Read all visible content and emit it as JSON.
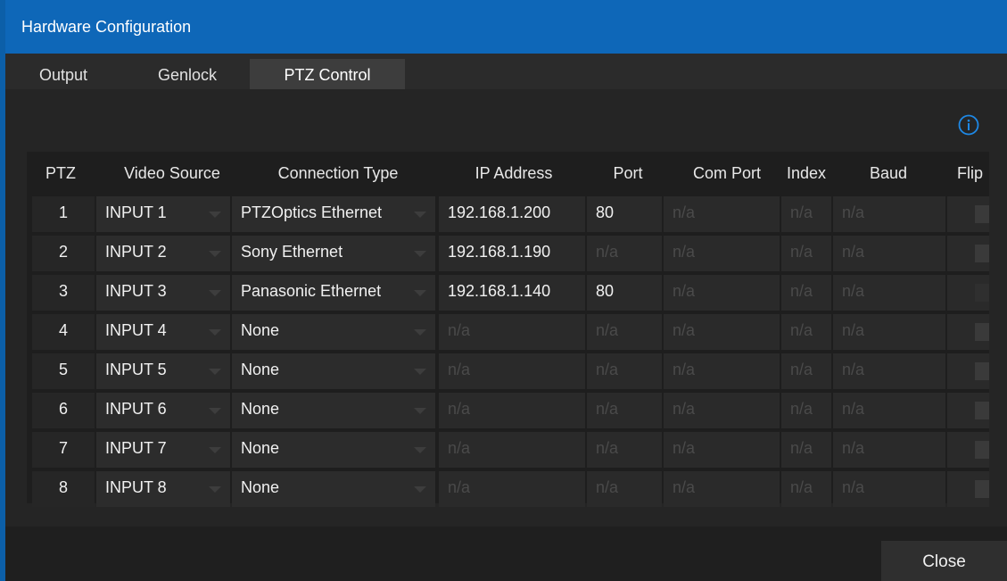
{
  "window": {
    "title": "Hardware Configuration"
  },
  "tabs": [
    {
      "label": "Output"
    },
    {
      "label": "Genlock"
    },
    {
      "label": "PTZ Control",
      "active": true
    }
  ],
  "info_icon": "info-icon",
  "table": {
    "columns": [
      "PTZ",
      "Video Source",
      "Connection Type",
      "IP Address",
      "Port",
      "Com Port",
      "Index",
      "Baud",
      "Flip"
    ],
    "rows": [
      {
        "ptz": "1",
        "video_source": "INPUT 1",
        "connection_type": "PTZOptics Ethernet",
        "ip_address": "192.168.1.200",
        "port": "80",
        "com_port": "n/a",
        "index": "n/a",
        "baud": "n/a",
        "flip": false
      },
      {
        "ptz": "2",
        "video_source": "INPUT 2",
        "connection_type": "Sony Ethernet",
        "ip_address": "192.168.1.190",
        "port": "n/a",
        "com_port": "n/a",
        "index": "n/a",
        "baud": "n/a",
        "flip": false
      },
      {
        "ptz": "3",
        "video_source": "INPUT 3",
        "connection_type": "Panasonic Ethernet",
        "ip_address": "192.168.1.140",
        "port": "80",
        "com_port": "n/a",
        "index": "n/a",
        "baud": "n/a",
        "flip": false
      },
      {
        "ptz": "4",
        "video_source": "INPUT 4",
        "connection_type": "None",
        "ip_address": "n/a",
        "port": "n/a",
        "com_port": "n/a",
        "index": "n/a",
        "baud": "n/a",
        "flip": false
      },
      {
        "ptz": "5",
        "video_source": "INPUT 5",
        "connection_type": "None",
        "ip_address": "n/a",
        "port": "n/a",
        "com_port": "n/a",
        "index": "n/a",
        "baud": "n/a",
        "flip": false
      },
      {
        "ptz": "6",
        "video_source": "INPUT 6",
        "connection_type": "None",
        "ip_address": "n/a",
        "port": "n/a",
        "com_port": "n/a",
        "index": "n/a",
        "baud": "n/a",
        "flip": false
      },
      {
        "ptz": "7",
        "video_source": "INPUT 7",
        "connection_type": "None",
        "ip_address": "n/a",
        "port": "n/a",
        "com_port": "n/a",
        "index": "n/a",
        "baud": "n/a",
        "flip": false
      },
      {
        "ptz": "8",
        "video_source": "INPUT 8",
        "connection_type": "None",
        "ip_address": "n/a",
        "port": "n/a",
        "com_port": "n/a",
        "index": "n/a",
        "baud": "n/a",
        "flip": false
      }
    ]
  },
  "footer": {
    "close_label": "Close"
  },
  "colors": {
    "title_bar": "#0e67b8",
    "window_border": "#0c5fa8",
    "info_icon": "#1e88e5",
    "na_text": "#4a4a4a"
  }
}
